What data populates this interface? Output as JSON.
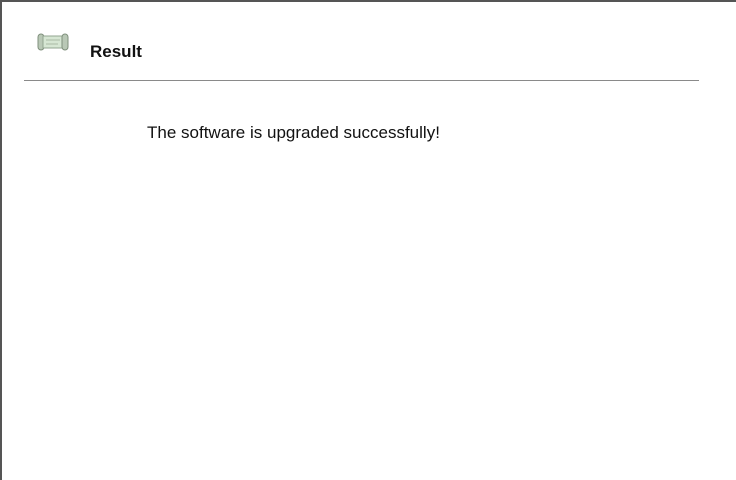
{
  "header": {
    "icon": "scroll-icon",
    "title": "Result"
  },
  "main": {
    "message": "The software is upgraded successfully!"
  }
}
